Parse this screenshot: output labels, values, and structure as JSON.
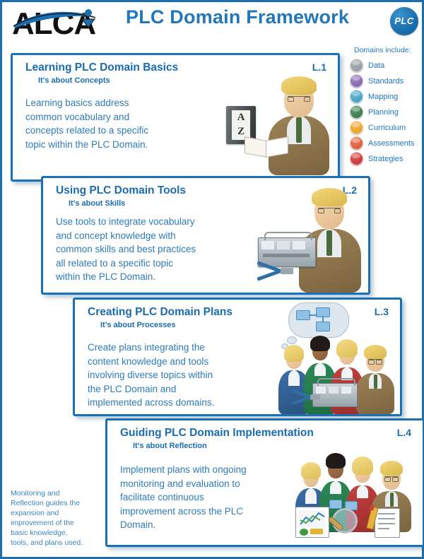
{
  "header": {
    "logo_text": "ALCA",
    "logo_name": "alca-logo",
    "title": "PLC Domain Framework",
    "badge_text": "PLC"
  },
  "legend": {
    "title": "Domains include:",
    "items": [
      {
        "label": "Data",
        "icon": "data-icon",
        "color": "#9aa0a6"
      },
      {
        "label": "Standards",
        "icon": "standards-icon",
        "color": "#8c6cb5"
      },
      {
        "label": "Mapping",
        "icon": "mapping-icon",
        "color": "#49a6c6"
      },
      {
        "label": "Planning",
        "icon": "planning-icon",
        "color": "#3f7d53"
      },
      {
        "label": "Curriculum",
        "icon": "curriculum-icon",
        "color": "#f0a52a"
      },
      {
        "label": "Assessments",
        "icon": "assessments-icon",
        "color": "#e0603c"
      },
      {
        "label": "Strategies",
        "icon": "strategies-icon",
        "color": "#cf3b3b"
      }
    ]
  },
  "cards": [
    {
      "level": "L.1",
      "title": "Learning PLC Domain Basics",
      "subtitle": "It's about Concepts",
      "body": "Learning basics address\ncommon vocabulary and\nconcepts related to a specific\ntopic within the PLC Domain.",
      "art": "person-with-dictionary-and-open-book"
    },
    {
      "level": "L.2",
      "title": "Using PLC Domain Tools",
      "subtitle": "It's about Skills",
      "body": "Use tools to integrate vocabulary\nand concept knowledge with\ncommon skills and best practices\nall related to a specific topic\nwithin the PLC Domain.",
      "art": "person-with-toolbox-and-pliers"
    },
    {
      "level": "L.3",
      "title": "Creating PLC Domain Plans",
      "subtitle": "It's about Processes",
      "body": "Create plans integrating the\ncontent knowledge and tools\ninvolving diverse topics within\nthe PLC Domain and\nimplemented across domains.",
      "art": "team-with-thought-bubble-flowchart-and-toolbox"
    },
    {
      "level": "L.4",
      "title": "Guiding PLC Domain Implementation",
      "subtitle": "It's about Reflection",
      "body": "Implement plans with ongoing\nmonitoring and evaluation to\nfacilitate continuous\nimprovement across the PLC\nDomain.",
      "art": "team-with-chart-magnifier-and-checklist"
    }
  ],
  "footnote": "Monitoring and\nReflection guides the\nexpansion and\nimprovement of the\nbasic knowledge,\ntools, and plans used.",
  "colors": {
    "accent": "#1a70b4",
    "title": "#2277bb",
    "body_text": "#2d7cb8",
    "frame": "#1b6fb0"
  }
}
